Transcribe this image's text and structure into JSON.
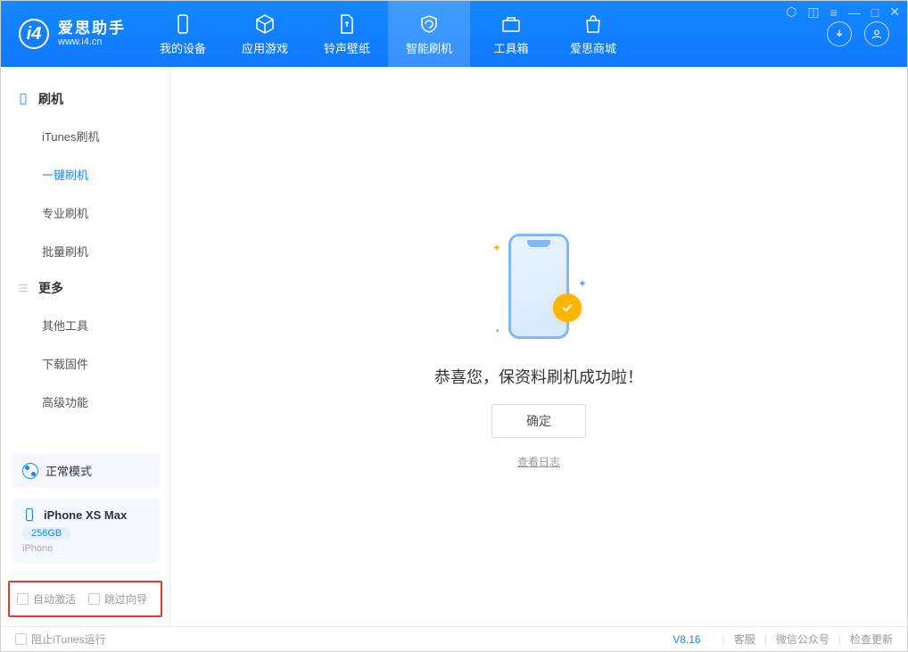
{
  "app": {
    "title": "爱思助手",
    "subtitle": "www.i4.cn"
  },
  "tabs": {
    "device": "我的设备",
    "apps": "应用游戏",
    "ringtone": "铃声壁纸",
    "flash": "智能刷机",
    "toolbox": "工具箱",
    "store": "爱思商城"
  },
  "sidebar": {
    "group_flash": "刷机",
    "items_flash": {
      "itunes": "iTunes刷机",
      "onekey": "一键刷机",
      "pro": "专业刷机",
      "batch": "批量刷机"
    },
    "group_more": "更多",
    "items_more": {
      "other": "其他工具",
      "firmware": "下载固件",
      "advanced": "高级功能"
    }
  },
  "mode": {
    "label": "正常模式"
  },
  "device": {
    "name": "iPhone XS Max",
    "capacity": "256GB",
    "type": "iPhone"
  },
  "options": {
    "auto_activate": "自动激活",
    "skip_guide": "跳过向导"
  },
  "main": {
    "success": "恭喜您，保资料刷机成功啦！",
    "confirm": "确定",
    "view_log": "查看日志"
  },
  "footer": {
    "block_itunes": "阻止iTunes运行",
    "version": "V8.16",
    "support": "客服",
    "wechat": "微信公众号",
    "update": "检查更新"
  }
}
